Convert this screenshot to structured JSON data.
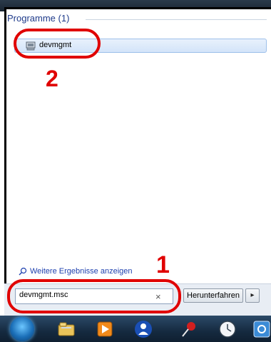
{
  "start_menu": {
    "group_title": "Programme (1)",
    "results": [
      {
        "label": "devmgmt",
        "icon": "device-manager-icon"
      }
    ],
    "more_results_link": "Weitere Ergebnisse anzeigen",
    "search": {
      "value": "devmgmt.msc",
      "clear_label": "×"
    },
    "shutdown_label": "Herunterfahren",
    "shutdown_arrow": "▸"
  },
  "annotations": {
    "step1": "1",
    "step2": "2",
    "color": "#e00000"
  },
  "taskbar": {
    "icons": [
      "start-orb-icon",
      "file-explorer-icon",
      "media-player-icon",
      "user-icon",
      "pin-icon",
      "clock-icon",
      "app-icon"
    ]
  }
}
